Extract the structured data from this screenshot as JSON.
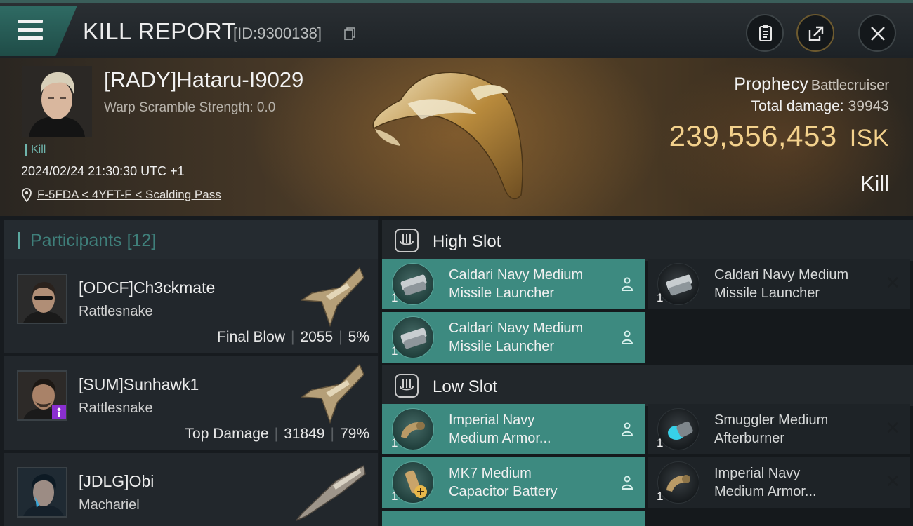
{
  "header": {
    "title": "KILL REPORT",
    "report_id": "[ID:9300138]",
    "icons": [
      "menu-icon",
      "copy-icon",
      "clipboard-icon",
      "share-icon",
      "close-icon"
    ]
  },
  "victim": {
    "name": "[RADY]Hataru-I9029",
    "warp_scramble": "Warp Scramble Strength: 0.0",
    "tag": "Kill",
    "datetime": "2024/02/24 21:30:30 UTC +1",
    "location": "F-5FDA < 4YFT-F < Scalding Pass",
    "ship_name": "Prophecy",
    "ship_class": "Battlecruiser",
    "total_damage_label": "Total damage:",
    "total_damage": "39943",
    "isk_value": "239,556,453",
    "isk_unit": "ISK",
    "result": "Kill"
  },
  "participants": {
    "label": "Participants",
    "count": "[12]",
    "items": [
      {
        "name": "[ODCF]Ch3ckmate",
        "ship": "Rattlesnake",
        "role": "Final Blow",
        "damage": "2055",
        "percent": "5%"
      },
      {
        "name": "[SUM]Sunhawk1",
        "ship": "Rattlesnake",
        "role": "Top Damage",
        "damage": "31849",
        "percent": "79%"
      },
      {
        "name": "[JDLG]Obi",
        "ship": "Machariel"
      }
    ]
  },
  "fitting": {
    "high_slot": {
      "label": "High Slot",
      "modules": [
        {
          "line1": "Caldari Navy Medium",
          "line2": "Missile Launcher",
          "qty": "1",
          "state": "fitted"
        },
        {
          "line1": "Caldari Navy Medium",
          "line2": "Missile Launcher",
          "qty": "1",
          "state": "destroyed"
        },
        {
          "line1": "Caldari Navy Medium",
          "line2": "Missile Launcher",
          "qty": "1",
          "state": "fitted"
        }
      ]
    },
    "low_slot": {
      "label": "Low Slot",
      "modules": [
        {
          "line1": "Imperial Navy",
          "line2": "Medium Armor...",
          "qty": "1",
          "state": "fitted"
        },
        {
          "line1": "Smuggler Medium",
          "line2": "Afterburner",
          "qty": "1",
          "state": "destroyed"
        },
        {
          "line1": "MK7 Medium",
          "line2": "Capacitor Battery",
          "qty": "1",
          "state": "fitted"
        },
        {
          "line1": "Imperial Navy",
          "line2": "Medium Armor...",
          "qty": "1",
          "state": "destroyed"
        }
      ]
    }
  },
  "colors": {
    "accent": "#3d8a80",
    "isk": "#f3d18c",
    "panel": "#22272c"
  }
}
